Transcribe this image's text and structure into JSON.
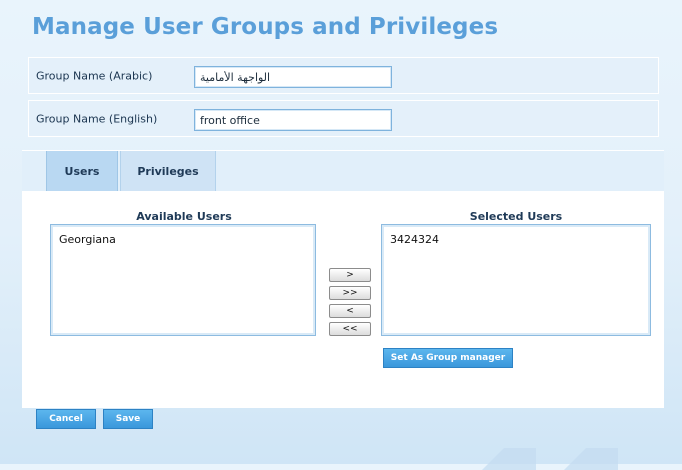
{
  "page": {
    "title": "Manage User Groups and Privileges"
  },
  "form": {
    "arabic_label": "Group Name (Arabic)",
    "arabic_value": "الواجهة الأمامية",
    "english_label": "Group Name (English)",
    "english_value": "front office"
  },
  "tabs": [
    {
      "label": "Users",
      "active": true
    },
    {
      "label": "Privileges",
      "active": false
    }
  ],
  "users_panel": {
    "available_title": "Available Users",
    "available_users": [
      "Georgiana"
    ],
    "selected_title": "Selected Users",
    "selected_users": [
      "3424324"
    ],
    "move_buttons": [
      ">",
      ">>",
      "<",
      "<<"
    ],
    "group_manager_label": "Set As Group manager"
  },
  "actions": {
    "cancel_label": "Cancel",
    "save_label": "Save"
  },
  "colors": {
    "title": "#5a9fd9",
    "button": "#3a97db",
    "background": "#e3f0fa"
  }
}
